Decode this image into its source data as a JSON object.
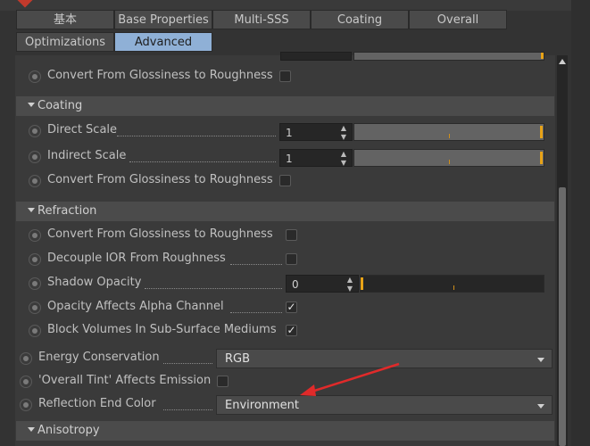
{
  "tabs_row1": [
    {
      "label": "基本",
      "active": false
    },
    {
      "label": "Base Properties",
      "active": false
    },
    {
      "label": "Multi-SSS",
      "active": false
    },
    {
      "label": "Coating",
      "active": false
    },
    {
      "label": "Overall",
      "active": false
    }
  ],
  "tabs_row2": [
    {
      "label": "Optimizations",
      "active": false
    },
    {
      "label": "Advanced",
      "active": true
    }
  ],
  "top_partial": {
    "row_label": "Convert From Glossiness to Roughness",
    "checked": false
  },
  "coating": {
    "header": "Coating",
    "direct_scale": {
      "label": "Direct Scale",
      "value": "1",
      "fraction": 1.0
    },
    "indirect_scale": {
      "label": "Indirect Scale",
      "value": "1",
      "fraction": 1.0
    },
    "convert": {
      "label": "Convert From Glossiness to Roughness",
      "checked": false
    }
  },
  "refraction": {
    "header": "Refraction",
    "convert": {
      "label": "Convert From Glossiness to Roughness",
      "checked": false
    },
    "decouple": {
      "label": "Decouple IOR From Roughness",
      "checked": false
    },
    "shadow_opacity": {
      "label": "Shadow Opacity",
      "value": "0",
      "fraction": 0.0
    },
    "opacity_alpha": {
      "label": "Opacity Affects Alpha Channel",
      "checked": true
    },
    "block_volumes": {
      "label": "Block Volumes In Sub-Surface Mediums",
      "checked": true
    }
  },
  "overall": {
    "energy": {
      "label": "Energy Conservation",
      "value": "RGB"
    },
    "overall_tint": {
      "label": "'Overall Tint' Affects Emission",
      "checked": false
    },
    "reflection_end": {
      "label": "Reflection End Color",
      "value": "Environment"
    }
  },
  "anisotropy": {
    "header": "Anisotropy"
  },
  "check_glyph": "✓",
  "colors": {
    "accent": "#e8a317",
    "active_tab": "#8fb0d6",
    "arrow": "#e02a2a"
  }
}
